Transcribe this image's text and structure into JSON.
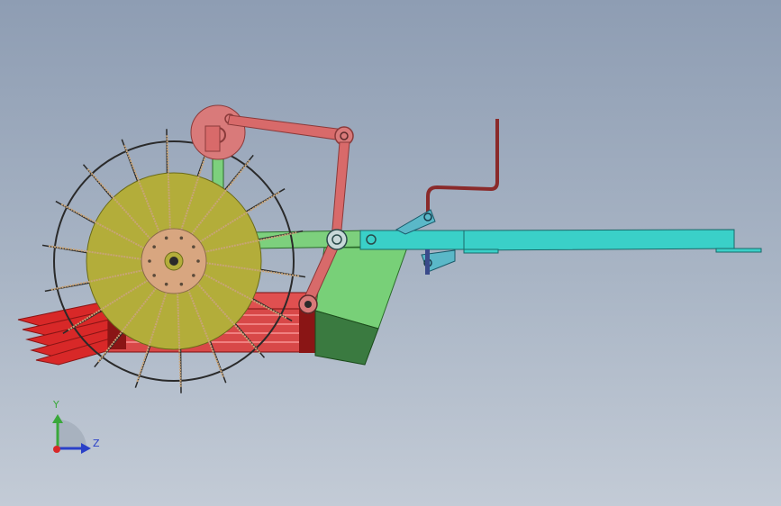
{
  "viewport": {
    "background_top": "#8e9db3",
    "background_bottom": "#c3cbd6"
  },
  "model": {
    "colors": {
      "drive_wheel": "#b3ad3a",
      "hub": "#d8a680",
      "spokes": "#c8a478",
      "rim": "#2a2a2a",
      "sprocket": "#d97a7a",
      "link_arm": "#d86a6a",
      "frame_green": "#7dd07d",
      "hopper_light": "#78d078",
      "hopper_dark": "#3a7a40",
      "boom": "#3ad0c8",
      "handle": "#8a2a2a",
      "tray": "#d82828",
      "bracket": "#3aa8c8"
    }
  },
  "triad": {
    "y_label": "Y",
    "z_label": "Z",
    "y_color": "#3aa83a",
    "z_color": "#2a40c8",
    "origin_color": "#d82828"
  }
}
